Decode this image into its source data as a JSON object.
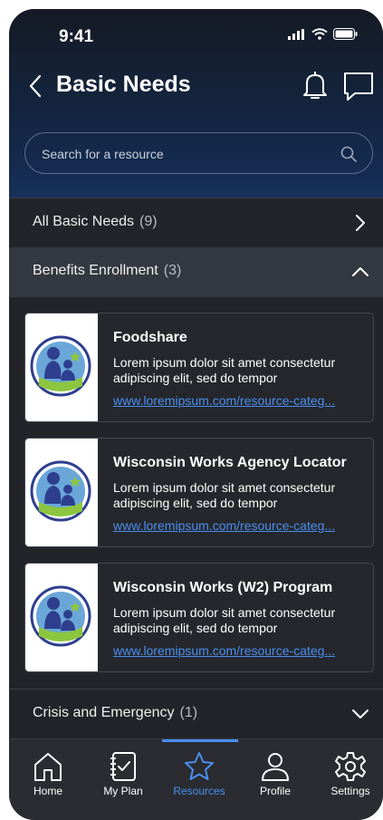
{
  "status_bar": {
    "time": "9:41"
  },
  "header": {
    "title": "Basic Needs"
  },
  "search": {
    "placeholder": "Search for a resource"
  },
  "categories": {
    "all": {
      "label": "All Basic Needs",
      "count": "(9)"
    },
    "benefits": {
      "label": "Benefits Enrollment",
      "count": "(3)"
    },
    "crisis": {
      "label": "Crisis and Emergency",
      "count": "(1)"
    }
  },
  "resources": [
    {
      "title": "Foodshare",
      "description": "Lorem ipsum dolor sit amet consectetur adipiscing elit, sed do tempor",
      "link": "www.loremipsum.com/resource-categ..."
    },
    {
      "title": "Wisconsin Works Agency Locator",
      "description": "Lorem ipsum dolor sit amet consectetur adipiscing elit, sed do tempor",
      "link": "www.loremipsum.com/resource-categ..."
    },
    {
      "title": "Wisconsin Works (W2) Program",
      "description": "Lorem ipsum dolor sit amet consectetur adipiscing elit, sed do tempor",
      "link": "www.loremipsum.com/resource-categ..."
    }
  ],
  "tabs": [
    {
      "label": "Home",
      "icon": "home-icon"
    },
    {
      "label": "My Plan",
      "icon": "plan-icon"
    },
    {
      "label": "Resources",
      "icon": "star-icon",
      "active": true
    },
    {
      "label": "Profile",
      "icon": "profile-icon"
    },
    {
      "label": "Settings",
      "icon": "gear-icon"
    }
  ],
  "colors": {
    "accent": "#4a8ff0",
    "background": "#222429",
    "header_gradient_end": "#17315a"
  }
}
